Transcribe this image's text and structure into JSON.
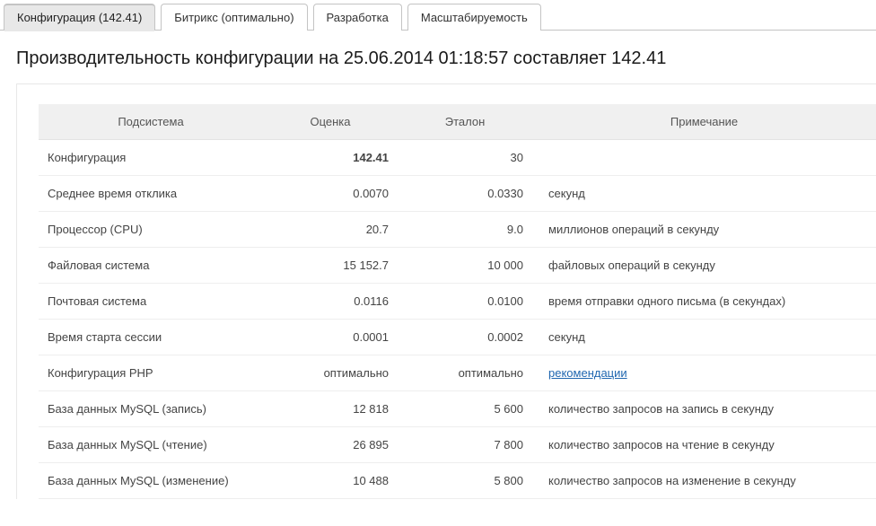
{
  "tabs": [
    {
      "label": "Конфигурация (142.41)",
      "active": true
    },
    {
      "label": "Битрикс (оптимально)",
      "active": false
    },
    {
      "label": "Разработка",
      "active": false
    },
    {
      "label": "Масштабируемость",
      "active": false
    }
  ],
  "title": "Производительность конфигурации на 25.06.2014 01:18:57 составляет 142.41",
  "columns": {
    "subsystem": "Подсистема",
    "score": "Оценка",
    "reference": "Эталон",
    "note": "Примечание"
  },
  "rows": [
    {
      "subsystem": "Конфигурация",
      "score": "142.41",
      "reference": "30",
      "note": "",
      "score_bold": true
    },
    {
      "subsystem": "Среднее время отклика",
      "score": "0.0070",
      "reference": "0.0330",
      "note": "секунд"
    },
    {
      "subsystem": "Процессор (CPU)",
      "score": "20.7",
      "reference": "9.0",
      "note": "миллионов операций в секунду"
    },
    {
      "subsystem": "Файловая система",
      "score": "15 152.7",
      "reference": "10 000",
      "note": "файловых операций в секунду"
    },
    {
      "subsystem": "Почтовая система",
      "score": "0.0116",
      "reference": "0.0100",
      "note": "время отправки одного письма (в секундах)"
    },
    {
      "subsystem": "Время старта сессии",
      "score": "0.0001",
      "reference": "0.0002",
      "note": "секунд"
    },
    {
      "subsystem": "Конфигурация PHP",
      "score": "оптимально",
      "reference": "оптимально",
      "note_link": "рекомендации"
    },
    {
      "subsystem": "База данных MySQL (запись)",
      "score": "12 818",
      "reference": "5 600",
      "note": "количество запросов на запись в секунду"
    },
    {
      "subsystem": "База данных MySQL (чтение)",
      "score": "26 895",
      "reference": "7 800",
      "note": "количество запросов на чтение в секунду"
    },
    {
      "subsystem": "База данных MySQL (изменение)",
      "score": "10 488",
      "reference": "5 800",
      "note": "количество запросов на изменение в секунду"
    }
  ]
}
